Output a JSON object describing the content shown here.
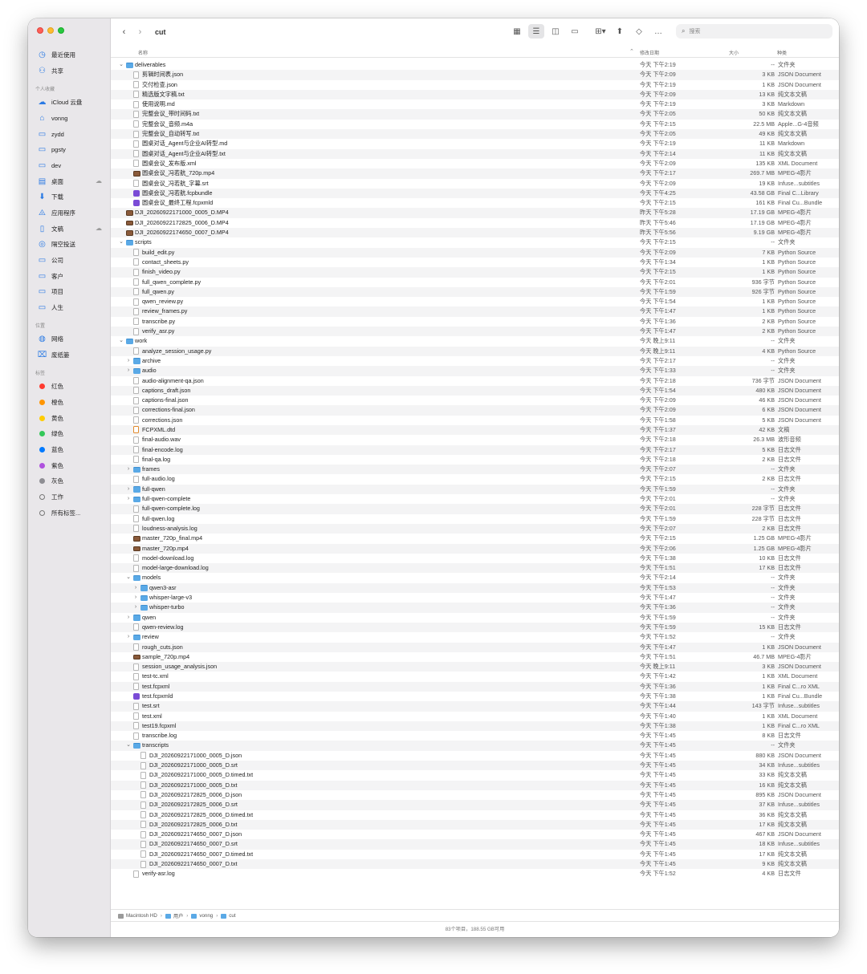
{
  "window": {
    "title": "cut"
  },
  "toolbar": {
    "search_placeholder": "搜索"
  },
  "sidebar": {
    "top": [
      {
        "label": "最近使用",
        "icon": "clock-icon"
      },
      {
        "label": "共享",
        "icon": "shared-icon"
      }
    ],
    "favorites_header": "个人收藏",
    "favorites": [
      {
        "label": "iCloud 云盘",
        "icon": "cloud-icon"
      },
      {
        "label": "vonng",
        "icon": "home-icon"
      },
      {
        "label": "zydd",
        "icon": "folder-icon"
      },
      {
        "label": "pgsty",
        "icon": "folder-icon"
      },
      {
        "label": "dev",
        "icon": "folder-icon"
      },
      {
        "label": "桌面",
        "icon": "desktop-icon"
      },
      {
        "label": "下载",
        "icon": "download-icon"
      },
      {
        "label": "应用程序",
        "icon": "applications-icon"
      },
      {
        "label": "文稿",
        "icon": "document-icon"
      },
      {
        "label": "隔空投送",
        "icon": "airdrop-icon"
      },
      {
        "label": "公司",
        "icon": "folder-icon"
      },
      {
        "label": "客户",
        "icon": "folder-icon"
      },
      {
        "label": "项目",
        "icon": "folder-icon"
      },
      {
        "label": "人生",
        "icon": "folder-icon"
      }
    ],
    "locations_header": "位置",
    "locations": [
      {
        "label": "网络",
        "icon": "network-icon"
      },
      {
        "label": "废纸篓",
        "icon": "trash-icon"
      }
    ],
    "tags_header": "标签",
    "tags": [
      {
        "label": "红色",
        "color": "#ff3b30"
      },
      {
        "label": "橙色",
        "color": "#ff9500"
      },
      {
        "label": "黄色",
        "color": "#ffcc00"
      },
      {
        "label": "绿色",
        "color": "#34c759"
      },
      {
        "label": "蓝色",
        "color": "#007aff"
      },
      {
        "label": "紫色",
        "color": "#af52de"
      },
      {
        "label": "灰色",
        "color": "#8e8e93"
      },
      {
        "label": "工作",
        "color": ""
      },
      {
        "label": "所有标签...",
        "color": ""
      }
    ]
  },
  "columns": {
    "name": "名称",
    "date": "修改日期",
    "size": "大小",
    "kind": "种类"
  },
  "files": [
    {
      "level": 0,
      "disc": "v",
      "icon": "folder",
      "name": "deliverables",
      "date": "今天 下午2:19",
      "size": "--",
      "kind": "文件夹"
    },
    {
      "level": 1,
      "disc": "",
      "icon": "doc",
      "name": "剪辑时间表.json",
      "date": "今天 下午2:09",
      "size": "3 KB",
      "kind": "JSON Document"
    },
    {
      "level": 1,
      "disc": "",
      "icon": "doc",
      "name": "交付检查.json",
      "date": "今天 下午2:19",
      "size": "1 KB",
      "kind": "JSON Document"
    },
    {
      "level": 1,
      "disc": "",
      "icon": "doc",
      "name": "精选版文字稿.txt",
      "date": "今天 下午2:09",
      "size": "13 KB",
      "kind": "纯文本文稿"
    },
    {
      "level": 1,
      "disc": "",
      "icon": "doc",
      "name": "使用说明.md",
      "date": "今天 下午2:19",
      "size": "3 KB",
      "kind": "Markdown"
    },
    {
      "level": 1,
      "disc": "",
      "icon": "doc",
      "name": "完整会议_带时间码.txt",
      "date": "今天 下午2:05",
      "size": "50 KB",
      "kind": "纯文本文稿"
    },
    {
      "level": 1,
      "disc": "",
      "icon": "audio",
      "name": "完整会议_音频.m4a",
      "date": "今天 下午2:15",
      "size": "22.5 MB",
      "kind": "Apple...G-4音频"
    },
    {
      "level": 1,
      "disc": "",
      "icon": "doc",
      "name": "完整会议_自动转写.txt",
      "date": "今天 下午2:05",
      "size": "49 KB",
      "kind": "纯文本文稿"
    },
    {
      "level": 1,
      "disc": "",
      "icon": "doc",
      "name": "圆桌对话_Agent与企业AI转型.md",
      "date": "今天 下午2:19",
      "size": "11 KB",
      "kind": "Markdown"
    },
    {
      "level": 1,
      "disc": "",
      "icon": "doc",
      "name": "圆桌对话_Agent与企业AI转型.txt",
      "date": "今天 下午2:14",
      "size": "11 KB",
      "kind": "纯文本文稿"
    },
    {
      "level": 1,
      "disc": "",
      "icon": "doc",
      "name": "圆桌会议_发布版.xml",
      "date": "今天 下午2:09",
      "size": "135 KB",
      "kind": "XML Document"
    },
    {
      "level": 1,
      "disc": "",
      "icon": "video",
      "name": "圆桌会议_冯若航_720p.mp4",
      "date": "今天 下午2:17",
      "size": "269.7 MB",
      "kind": "MPEG-4影片"
    },
    {
      "level": 1,
      "disc": "",
      "icon": "doc",
      "name": "圆桌会议_冯若航_字幕.srt",
      "date": "今天 下午2:09",
      "size": "19 KB",
      "kind": "Infuse...subtitles"
    },
    {
      "level": 1,
      "disc": "",
      "icon": "bundle",
      "name": "圆桌会议_冯若航.fcpbundle",
      "date": "今天 下午4:25",
      "size": "43.58 GB",
      "kind": "Final C...Library"
    },
    {
      "level": 1,
      "disc": "",
      "icon": "bundle",
      "name": "圆桌会议_最终工程.fcpxmld",
      "date": "今天 下午2:15",
      "size": "161 KB",
      "kind": "Final Cu...Bundle"
    },
    {
      "level": 0,
      "disc": "",
      "icon": "video",
      "name": "DJI_20260922171000_0005_D.MP4",
      "date": "昨天 下午5:28",
      "size": "17.19 GB",
      "kind": "MPEG-4影片"
    },
    {
      "level": 0,
      "disc": "",
      "icon": "video",
      "name": "DJI_20260922172825_0006_D.MP4",
      "date": "昨天 下午5:46",
      "size": "17.19 GB",
      "kind": "MPEG-4影片"
    },
    {
      "level": 0,
      "disc": "",
      "icon": "video",
      "name": "DJI_20260922174650_0007_D.MP4",
      "date": "昨天 下午5:56",
      "size": "9.19 GB",
      "kind": "MPEG-4影片"
    },
    {
      "level": 0,
      "disc": "v",
      "icon": "folder",
      "name": "scripts",
      "date": "今天 下午2:15",
      "size": "--",
      "kind": "文件夹"
    },
    {
      "level": 1,
      "disc": "",
      "icon": "doc",
      "name": "build_edit.py",
      "date": "今天 下午2:09",
      "size": "7 KB",
      "kind": "Python Source"
    },
    {
      "level": 1,
      "disc": "",
      "icon": "doc",
      "name": "contact_sheets.py",
      "date": "今天 下午1:34",
      "size": "1 KB",
      "kind": "Python Source"
    },
    {
      "level": 1,
      "disc": "",
      "icon": "doc",
      "name": "finish_video.py",
      "date": "今天 下午2:15",
      "size": "1 KB",
      "kind": "Python Source"
    },
    {
      "level": 1,
      "disc": "",
      "icon": "doc",
      "name": "full_qwen_complete.py",
      "date": "今天 下午2:01",
      "size": "936 字节",
      "kind": "Python Source"
    },
    {
      "level": 1,
      "disc": "",
      "icon": "doc",
      "name": "full_qwen.py",
      "date": "今天 下午1:59",
      "size": "926 字节",
      "kind": "Python Source"
    },
    {
      "level": 1,
      "disc": "",
      "icon": "doc",
      "name": "qwen_review.py",
      "date": "今天 下午1:54",
      "size": "1 KB",
      "kind": "Python Source"
    },
    {
      "level": 1,
      "disc": "",
      "icon": "doc",
      "name": "review_frames.py",
      "date": "今天 下午1:47",
      "size": "1 KB",
      "kind": "Python Source"
    },
    {
      "level": 1,
      "disc": "",
      "icon": "doc",
      "name": "transcribe.py",
      "date": "今天 下午1:36",
      "size": "2 KB",
      "kind": "Python Source"
    },
    {
      "level": 1,
      "disc": "",
      "icon": "doc",
      "name": "verify_asr.py",
      "date": "今天 下午1:47",
      "size": "2 KB",
      "kind": "Python Source"
    },
    {
      "level": 0,
      "disc": "v",
      "icon": "folder",
      "name": "work",
      "date": "今天 晚上9:11",
      "size": "--",
      "kind": "文件夹"
    },
    {
      "level": 1,
      "disc": "",
      "icon": "doc",
      "name": "analyze_session_usage.py",
      "date": "今天 晚上9:11",
      "size": "4 KB",
      "kind": "Python Source"
    },
    {
      "level": 1,
      "disc": ">",
      "icon": "folder",
      "name": "archive",
      "date": "今天 下午2:17",
      "size": "--",
      "kind": "文件夹"
    },
    {
      "level": 1,
      "disc": ">",
      "icon": "folder",
      "name": "audio",
      "date": "今天 下午1:33",
      "size": "--",
      "kind": "文件夹"
    },
    {
      "level": 1,
      "disc": "",
      "icon": "doc",
      "name": "audio-alignment-qa.json",
      "date": "今天 下午2:18",
      "size": "736 字节",
      "kind": "JSON Document"
    },
    {
      "level": 1,
      "disc": "",
      "icon": "doc",
      "name": "captions_draft.json",
      "date": "今天 下午1:54",
      "size": "480 KB",
      "kind": "JSON Document"
    },
    {
      "level": 1,
      "disc": "",
      "icon": "doc",
      "name": "captions-final.json",
      "date": "今天 下午2:09",
      "size": "46 KB",
      "kind": "JSON Document"
    },
    {
      "level": 1,
      "disc": "",
      "icon": "doc",
      "name": "corrections-final.json",
      "date": "今天 下午2:09",
      "size": "6 KB",
      "kind": "JSON Document"
    },
    {
      "level": 1,
      "disc": "",
      "icon": "doc",
      "name": "corrections.json",
      "date": "今天 下午1:58",
      "size": "5 KB",
      "kind": "JSON Document"
    },
    {
      "level": 1,
      "disc": "",
      "icon": "xmlish",
      "name": "FCPXML.dtd",
      "date": "今天 下午1:37",
      "size": "42 KB",
      "kind": "文稿"
    },
    {
      "level": 1,
      "disc": "",
      "icon": "audio",
      "name": "final-audio.wav",
      "date": "今天 下午2:18",
      "size": "26.3 MB",
      "kind": "波形音频"
    },
    {
      "level": 1,
      "disc": "",
      "icon": "doc",
      "name": "final-encode.log",
      "date": "今天 下午2:17",
      "size": "5 KB",
      "kind": "日志文件"
    },
    {
      "level": 1,
      "disc": "",
      "icon": "doc",
      "name": "final-qa.log",
      "date": "今天 下午2:18",
      "size": "2 KB",
      "kind": "日志文件"
    },
    {
      "level": 1,
      "disc": ">",
      "icon": "folder",
      "name": "frames",
      "date": "今天 下午2:07",
      "size": "--",
      "kind": "文件夹"
    },
    {
      "level": 1,
      "disc": "",
      "icon": "doc",
      "name": "full-audio.log",
      "date": "今天 下午2:15",
      "size": "2 KB",
      "kind": "日志文件"
    },
    {
      "level": 1,
      "disc": ">",
      "icon": "folder",
      "name": "full-qwen",
      "date": "今天 下午1:59",
      "size": "--",
      "kind": "文件夹"
    },
    {
      "level": 1,
      "disc": ">",
      "icon": "folder",
      "name": "full-qwen-complete",
      "date": "今天 下午2:01",
      "size": "--",
      "kind": "文件夹"
    },
    {
      "level": 1,
      "disc": "",
      "icon": "doc",
      "name": "full-qwen-complete.log",
      "date": "今天 下午2:01",
      "size": "228 字节",
      "kind": "日志文件"
    },
    {
      "level": 1,
      "disc": "",
      "icon": "doc",
      "name": "full-qwen.log",
      "date": "今天 下午1:59",
      "size": "228 字节",
      "kind": "日志文件"
    },
    {
      "level": 1,
      "disc": "",
      "icon": "doc",
      "name": "loudness-analysis.log",
      "date": "今天 下午2:07",
      "size": "2 KB",
      "kind": "日志文件"
    },
    {
      "level": 1,
      "disc": "",
      "icon": "video",
      "name": "master_720p_final.mp4",
      "date": "今天 下午2:15",
      "size": "1.25 GB",
      "kind": "MPEG-4影片"
    },
    {
      "level": 1,
      "disc": "",
      "icon": "video",
      "name": "master_720p.mp4",
      "date": "今天 下午2:06",
      "size": "1.25 GB",
      "kind": "MPEG-4影片"
    },
    {
      "level": 1,
      "disc": "",
      "icon": "doc",
      "name": "model-download.log",
      "date": "今天 下午1:38",
      "size": "10 KB",
      "kind": "日志文件"
    },
    {
      "level": 1,
      "disc": "",
      "icon": "doc",
      "name": "model-large-download.log",
      "date": "今天 下午1:51",
      "size": "17 KB",
      "kind": "日志文件"
    },
    {
      "level": 1,
      "disc": "v",
      "icon": "folder",
      "name": "models",
      "date": "今天 下午2:14",
      "size": "--",
      "kind": "文件夹"
    },
    {
      "level": 2,
      "disc": ">",
      "icon": "folder",
      "name": "qwen3-asr",
      "date": "今天 下午1:53",
      "size": "--",
      "kind": "文件夹"
    },
    {
      "level": 2,
      "disc": ">",
      "icon": "folder",
      "name": "whisper-large-v3",
      "date": "今天 下午1:47",
      "size": "--",
      "kind": "文件夹"
    },
    {
      "level": 2,
      "disc": ">",
      "icon": "folder",
      "name": "whisper-turbo",
      "date": "今天 下午1:36",
      "size": "--",
      "kind": "文件夹"
    },
    {
      "level": 1,
      "disc": ">",
      "icon": "folder",
      "name": "qwen",
      "date": "今天 下午1:59",
      "size": "--",
      "kind": "文件夹"
    },
    {
      "level": 1,
      "disc": "",
      "icon": "doc",
      "name": "qwen-review.log",
      "date": "今天 下午1:59",
      "size": "15 KB",
      "kind": "日志文件"
    },
    {
      "level": 1,
      "disc": ">",
      "icon": "folder",
      "name": "review",
      "date": "今天 下午1:52",
      "size": "--",
      "kind": "文件夹"
    },
    {
      "level": 1,
      "disc": "",
      "icon": "doc",
      "name": "rough_cuts.json",
      "date": "今天 下午1:47",
      "size": "1 KB",
      "kind": "JSON Document"
    },
    {
      "level": 1,
      "disc": "",
      "icon": "video",
      "name": "sample_720p.mp4",
      "date": "今天 下午1:51",
      "size": "46.7 MB",
      "kind": "MPEG-4影片"
    },
    {
      "level": 1,
      "disc": "",
      "icon": "doc",
      "name": "session_usage_analysis.json",
      "date": "今天 晚上9:11",
      "size": "3 KB",
      "kind": "JSON Document"
    },
    {
      "level": 1,
      "disc": "",
      "icon": "doc",
      "name": "test-tc.xml",
      "date": "今天 下午1:42",
      "size": "1 KB",
      "kind": "XML Document"
    },
    {
      "level": 1,
      "disc": "",
      "icon": "doc",
      "name": "test.fcpxml",
      "date": "今天 下午1:36",
      "size": "1 KB",
      "kind": "Final C...ro XML"
    },
    {
      "level": 1,
      "disc": "",
      "icon": "bundle",
      "name": "test.fcpxmld",
      "date": "今天 下午1:38",
      "size": "1 KB",
      "kind": "Final Cu...Bundle"
    },
    {
      "level": 1,
      "disc": "",
      "icon": "doc",
      "name": "test.srt",
      "date": "今天 下午1:44",
      "size": "143 字节",
      "kind": "Infuse...subtitles"
    },
    {
      "level": 1,
      "disc": "",
      "icon": "doc",
      "name": "test.xml",
      "date": "今天 下午1:40",
      "size": "1 KB",
      "kind": "XML Document"
    },
    {
      "level": 1,
      "disc": "",
      "icon": "doc",
      "name": "test19.fcpxml",
      "date": "今天 下午1:38",
      "size": "1 KB",
      "kind": "Final C...ro XML"
    },
    {
      "level": 1,
      "disc": "",
      "icon": "doc",
      "name": "transcribe.log",
      "date": "今天 下午1:45",
      "size": "8 KB",
      "kind": "日志文件"
    },
    {
      "level": 1,
      "disc": "v",
      "icon": "folder",
      "name": "transcripts",
      "date": "今天 下午1:45",
      "size": "--",
      "kind": "文件夹"
    },
    {
      "level": 2,
      "disc": "",
      "icon": "doc",
      "name": "DJI_20260922171000_0005_D.json",
      "date": "今天 下午1:45",
      "size": "880 KB",
      "kind": "JSON Document"
    },
    {
      "level": 2,
      "disc": "",
      "icon": "doc",
      "name": "DJI_20260922171000_0005_D.srt",
      "date": "今天 下午1:45",
      "size": "34 KB",
      "kind": "Infuse...subtitles"
    },
    {
      "level": 2,
      "disc": "",
      "icon": "doc",
      "name": "DJI_20260922171000_0005_D.timed.txt",
      "date": "今天 下午1:45",
      "size": "33 KB",
      "kind": "纯文本文稿"
    },
    {
      "level": 2,
      "disc": "",
      "icon": "doc",
      "name": "DJI_20260922171000_0005_D.txt",
      "date": "今天 下午1:45",
      "size": "16 KB",
      "kind": "纯文本文稿"
    },
    {
      "level": 2,
      "disc": "",
      "icon": "doc",
      "name": "DJI_20260922172825_0006_D.json",
      "date": "今天 下午1:45",
      "size": "895 KB",
      "kind": "JSON Document"
    },
    {
      "level": 2,
      "disc": "",
      "icon": "doc",
      "name": "DJI_20260922172825_0006_D.srt",
      "date": "今天 下午1:45",
      "size": "37 KB",
      "kind": "Infuse...subtitles"
    },
    {
      "level": 2,
      "disc": "",
      "icon": "doc",
      "name": "DJI_20260922172825_0006_D.timed.txt",
      "date": "今天 下午1:45",
      "size": "36 KB",
      "kind": "纯文本文稿"
    },
    {
      "level": 2,
      "disc": "",
      "icon": "doc",
      "name": "DJI_20260922172825_0006_D.txt",
      "date": "今天 下午1:45",
      "size": "17 KB",
      "kind": "纯文本文稿"
    },
    {
      "level": 2,
      "disc": "",
      "icon": "doc",
      "name": "DJI_20260922174650_0007_D.json",
      "date": "今天 下午1:45",
      "size": "467 KB",
      "kind": "JSON Document"
    },
    {
      "level": 2,
      "disc": "",
      "icon": "doc",
      "name": "DJI_20260922174650_0007_D.srt",
      "date": "今天 下午1:45",
      "size": "18 KB",
      "kind": "Infuse...subtitles"
    },
    {
      "level": 2,
      "disc": "",
      "icon": "doc",
      "name": "DJI_20260922174650_0007_D.timed.txt",
      "date": "今天 下午1:45",
      "size": "17 KB",
      "kind": "纯文本文稿"
    },
    {
      "level": 2,
      "disc": "",
      "icon": "doc",
      "name": "DJI_20260922174650_0007_D.txt",
      "date": "今天 下午1:45",
      "size": "9 KB",
      "kind": "纯文本文稿"
    },
    {
      "level": 1,
      "disc": "",
      "icon": "doc",
      "name": "verify-asr.log",
      "date": "今天 下午1:52",
      "size": "4 KB",
      "kind": "日志文件"
    }
  ],
  "pathbar": [
    "Macintosh HD",
    "用户",
    "vonng",
    "cut"
  ],
  "status": "83个项目，188.55 GB可用"
}
